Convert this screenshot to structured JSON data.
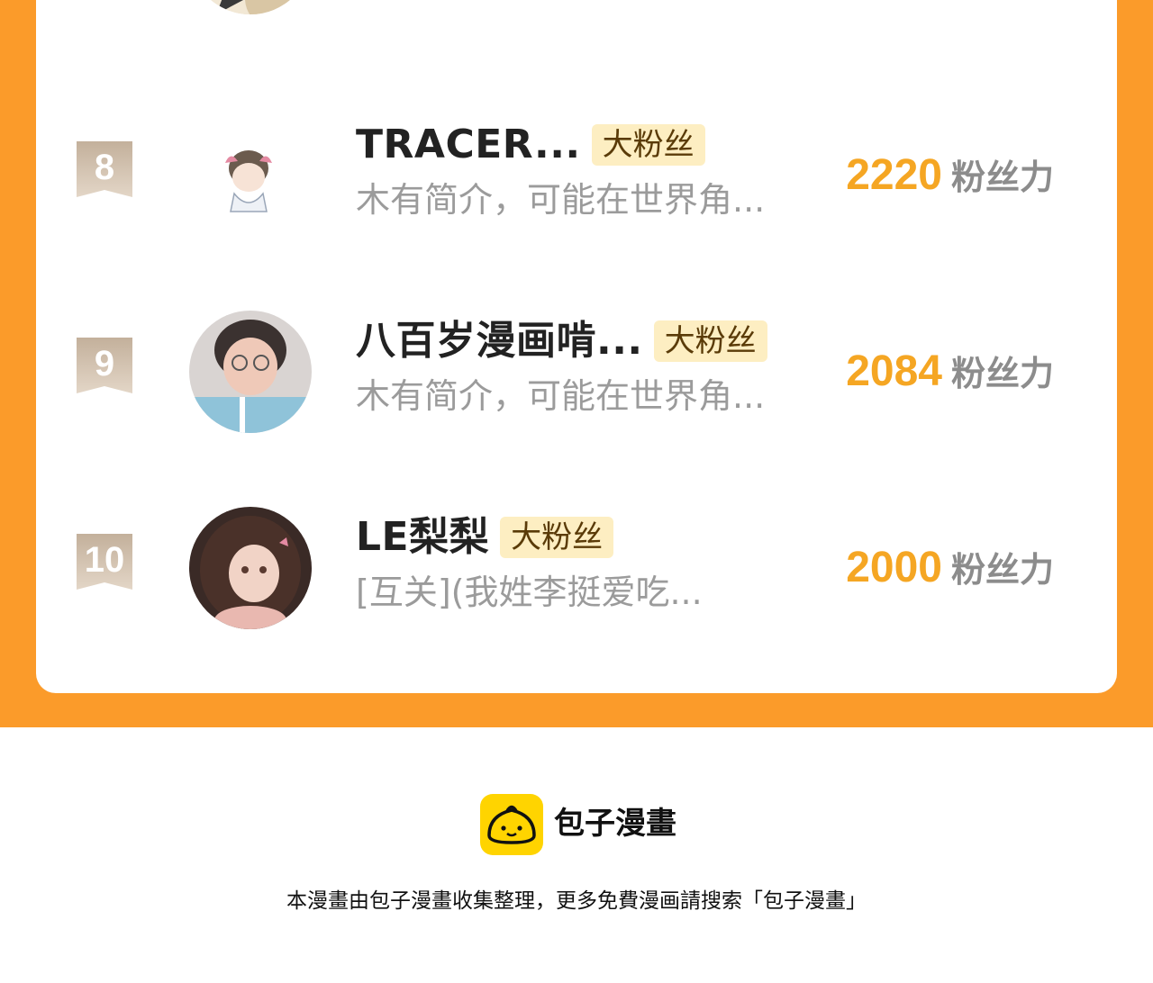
{
  "ranking": {
    "previous_rank": {
      "bio_partial": ""
    },
    "rows": [
      {
        "rank": "8",
        "name": "TRACER...",
        "tag": "大粉丝",
        "bio": "木有简介，可能在世界角...",
        "power": "2220",
        "power_unit": "粉丝力"
      },
      {
        "rank": "9",
        "name": "八百岁漫画啃...",
        "tag": "大粉丝",
        "bio": "木有简介，可能在世界角...",
        "power": "2084",
        "power_unit": "粉丝力"
      },
      {
        "rank": "10",
        "name": "LE梨梨",
        "tag": "大粉丝",
        "bio": "[互关](我姓李挺爱吃...",
        "power": "2000",
        "power_unit": "粉丝力"
      }
    ]
  },
  "colors": {
    "background_orange": "#fb9b2a",
    "power_number": "#f5a623",
    "tag_background": "#fdeec2",
    "rank_badge": "#c9b8a6"
  },
  "footer": {
    "brand_name": "包子漫畫",
    "brand_icon": "bun-logo-icon",
    "note": "本漫畫由包子漫畫收集整理，更多免費漫画請搜索「包子漫畫」"
  }
}
